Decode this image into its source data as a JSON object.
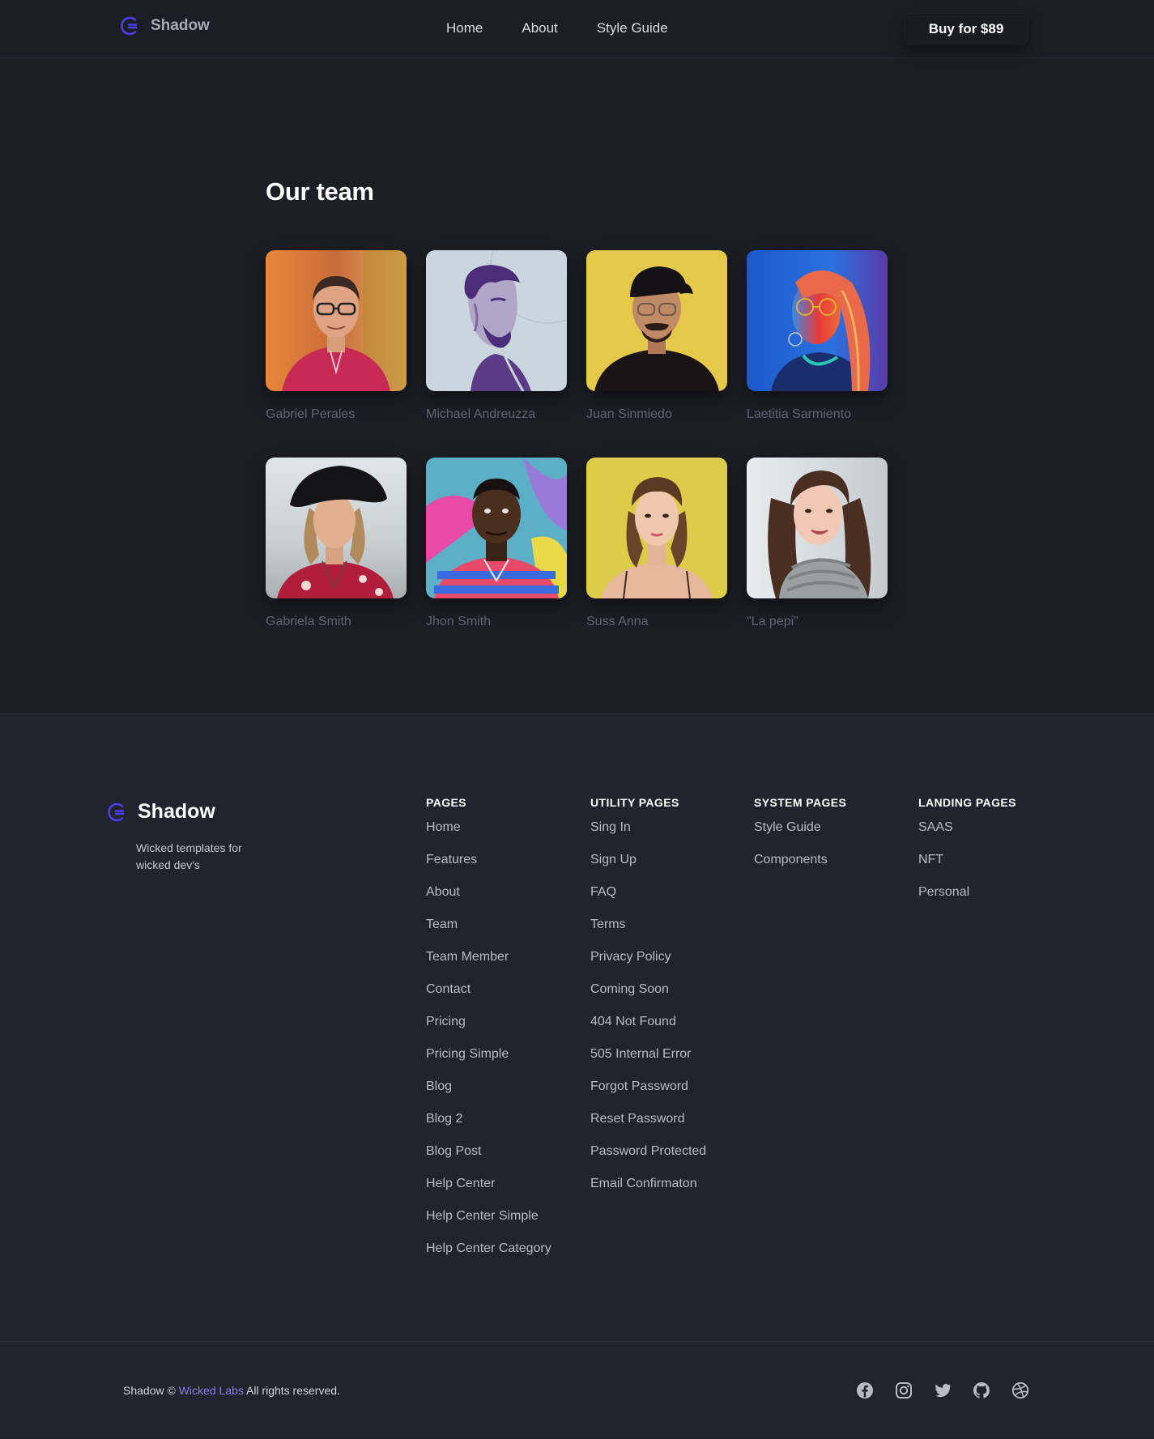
{
  "brand": {
    "name": "Shadow",
    "accent": "#4b3df0",
    "link_color": "#8f7cf0"
  },
  "header": {
    "nav": [
      "Home",
      "About",
      "Style Guide"
    ],
    "buy_label": "Buy for $89"
  },
  "team": {
    "title": "Our team",
    "members": [
      {
        "name": "Gabriel Perales",
        "photo": "man-glasses-red-shirt"
      },
      {
        "name": "Michael Andreuzza",
        "photo": "duotone-man-portrait"
      },
      {
        "name": "Juan Sinmiedo",
        "photo": "man-cap-glasses-yellow"
      },
      {
        "name": "Laetitia Sarmiento",
        "photo": "woman-neon-glasses"
      },
      {
        "name": "Gabriela Smith",
        "photo": "woman-black-hat"
      },
      {
        "name": "Jhon Smith",
        "photo": "man-striped-shirt-graffiti"
      },
      {
        "name": "Suss Anna",
        "photo": "woman-yellow-background"
      },
      {
        "name": "\"La pepi\"",
        "photo": "woman-grey-scarf"
      }
    ]
  },
  "footer": {
    "brand_name": "Shadow",
    "tagline": "Wicked templates for wicked dev's",
    "columns": [
      {
        "title": "PAGES",
        "links": [
          "Home",
          "Features",
          "About",
          "Team",
          "Team Member",
          "Contact",
          "Pricing",
          "Pricing Simple",
          "Blog",
          "Blog 2",
          "Blog Post",
          "Help Center",
          "Help Center Simple",
          "Help Center Category"
        ]
      },
      {
        "title": "UTILITY PAGES",
        "links": [
          "Sing In",
          "Sign Up",
          "FAQ",
          "Terms",
          "Privacy Policy",
          "Coming Soon",
          "404 Not Found",
          "505 Internal Error",
          "Forgot Password",
          "Reset Password",
          "Password Protected",
          "Email Confirmaton"
        ]
      },
      {
        "title": "SYSTEM PAGES",
        "links": [
          "Style Guide",
          "Components"
        ]
      },
      {
        "title": "LANDING PAGES",
        "links": [
          "SAAS",
          "NFT",
          "Personal"
        ]
      }
    ],
    "copyright": {
      "prefix": "Shadow ©",
      "link": "Wicked Labs",
      "suffix": "All rights reserved."
    },
    "socials": [
      "facebook-icon",
      "instagram-icon",
      "twitter-icon",
      "github-icon",
      "dribbble-icon"
    ]
  }
}
